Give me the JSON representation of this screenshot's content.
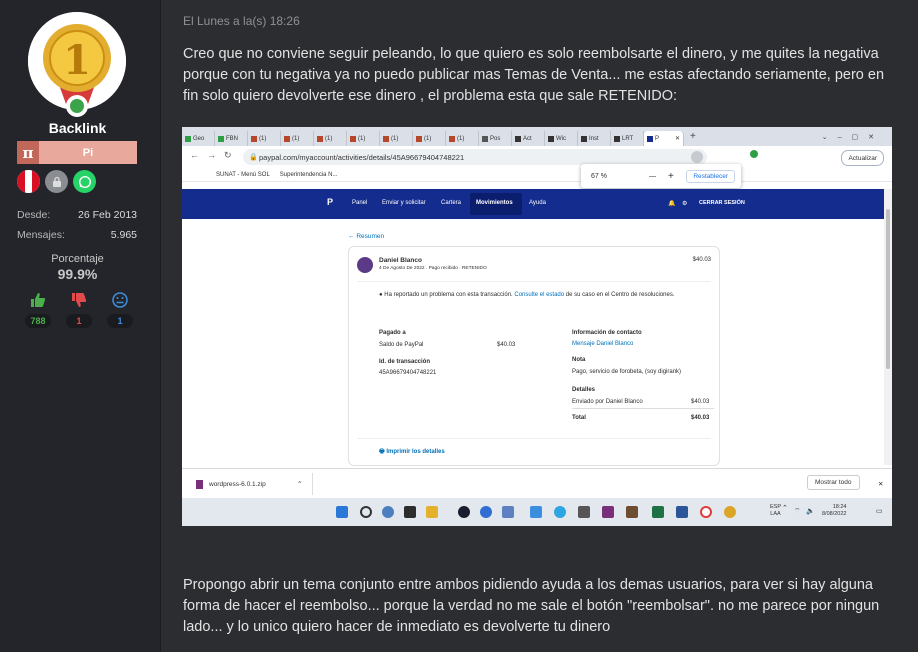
{
  "user": {
    "name": "Backlink",
    "rank_symbol": "π",
    "rank_label": "Pi",
    "since_label": "Desde:",
    "since_value": "26 Feb 2013",
    "messages_label": "Mensajes:",
    "messages_value": "5.965",
    "percentage_label": "Porcentaje",
    "percentage_value": "99.9%",
    "likes": "788",
    "dislikes": "1",
    "neutral": "1",
    "avatar_number": "1"
  },
  "post": {
    "timestamp": "El Lunes a la(s) 18:26",
    "paragraph_1": "Creo que no conviene seguir peleando, lo que quiero es solo reembolsarte el dinero, y me quites la negativa porque con tu negativa ya no puedo publicar mas Temas de Venta... me estas afectando seriamente, pero en fin solo quiero devolverte ese dinero , el problema esta que sale RETENIDO:",
    "paragraph_2": "Propongo abrir un tema conjunto entre ambos pidiendo ayuda a los demas usuarios, para ver si hay alguna forma de hacer el reembolso... porque la verdad no me sale el botón \"reembolsar\". no me parece por ningun lado... y lo unico quiero hacer de inmediato es devolverte tu dinero"
  },
  "screenshot": {
    "tabs": [
      "Geo",
      "FBN",
      "(1)",
      "(1)",
      "(1)",
      "(1)",
      "(1)",
      "(1)",
      "(1)",
      "Pos",
      "Act",
      "Wic",
      "Inst",
      "LRT",
      "P"
    ],
    "url": "paypal.com/myaccount/activities/details/45A96679404748221",
    "update_button": "Actualizar",
    "bookmarks": [
      "SUNAT - Menú SOL",
      "Superintendencia N..."
    ],
    "zoom": {
      "value": "67 %",
      "minus": "—",
      "plus": "+",
      "reset": "Restablecer"
    },
    "nav": [
      "Panel",
      "Enviar y solicitar",
      "Cartera",
      "Movimientos",
      "Ayuda"
    ],
    "logout": "CERRAR SESIÓN",
    "back": "Resumen",
    "card": {
      "payee": "Daniel Blanco",
      "amount": "$40.03",
      "subtitle": "4 De Agosto De 2022 . Pago recibido . RETENIDO",
      "notice_pre": "Ha reportado un problema con esta transacción.",
      "notice_link": "Consulte el estado",
      "notice_post": "de su caso en el Centro de resoluciones.",
      "paid_to_label": "Pagado a",
      "paid_to_value": "Saldo de PayPal",
      "paid_to_amount": "$40.03",
      "txn_label": "Id. de transacción",
      "txn_value": "45A96679404748221",
      "contact_label": "Información de contacto",
      "contact_link": "Mensaje Daniel Blanco",
      "note_label": "Nota",
      "note_value": "Pago, servicio de forobeta, (soy digirank)",
      "details_label": "Detalles",
      "details_line": "Enviado por Daniel Blanco",
      "details_amount": "$40.03",
      "total_label": "Total",
      "total_amount": "$40.03",
      "print": "Imprimir los detalles"
    },
    "download": {
      "file": "wordpress-6.0.1.zip",
      "show_all": "Mostrar todo"
    },
    "taskbar": {
      "lang_1": "ESP",
      "lang_2": "LAA",
      "time": "18:24",
      "date": "8/08/2022"
    }
  }
}
